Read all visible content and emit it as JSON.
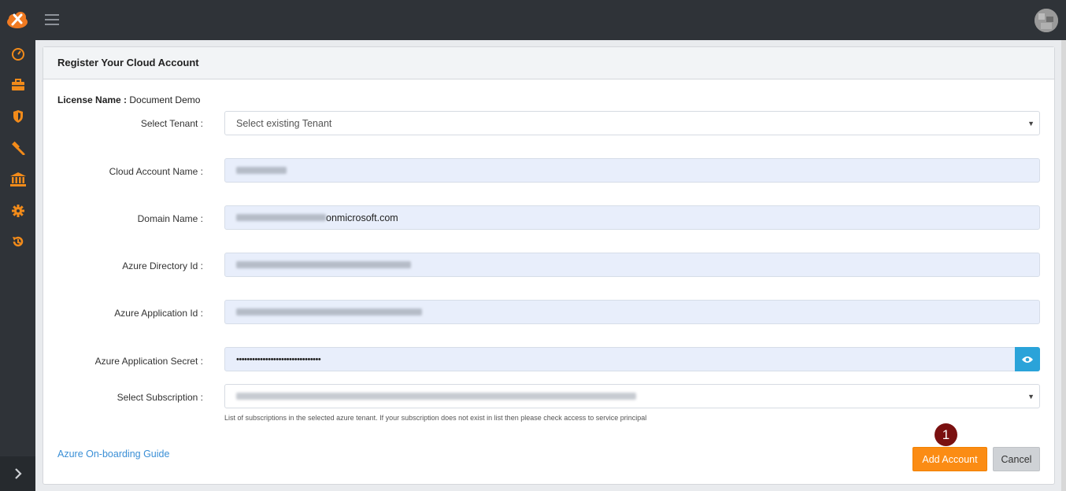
{
  "header": {
    "title": "Register Your Cloud Account"
  },
  "license": {
    "label": "License Name :",
    "value": "Document Demo"
  },
  "form": {
    "tenant": {
      "label": "Select Tenant :",
      "placeholder": "Select existing Tenant"
    },
    "cloud_account_name": {
      "label": "Cloud Account Name :"
    },
    "domain_name": {
      "label": "Domain Name :",
      "value_suffix": "onmicrosoft.com"
    },
    "azure_directory_id": {
      "label": "Azure Directory Id :"
    },
    "azure_application_id": {
      "label": "Azure Application Id :"
    },
    "azure_application_secret": {
      "label": "Azure Application Secret :",
      "value": "••••••••••••••••••••••••••••••••"
    },
    "subscription": {
      "label": "Select Subscription :",
      "help": "List of subscriptions in the selected azure tenant. If your subscription does not exist in list then please check access to service principal"
    }
  },
  "links": {
    "guide": "Azure On-boarding Guide"
  },
  "buttons": {
    "add": "Add Account",
    "cancel": "Cancel"
  },
  "annotation": {
    "step": "1"
  },
  "colors": {
    "accent": "#fb8c14",
    "sidebar": "#2f3338",
    "eye_button": "#2aa3d9",
    "badge": "#7a1010",
    "link": "#3a8fd6"
  },
  "icons": [
    "logo",
    "dashboard-icon",
    "briefcase-icon",
    "shield-icon",
    "hammer-icon",
    "bank-icon",
    "gear-icon",
    "history-icon",
    "chevron-right-icon",
    "menu-icon",
    "eye-icon"
  ]
}
